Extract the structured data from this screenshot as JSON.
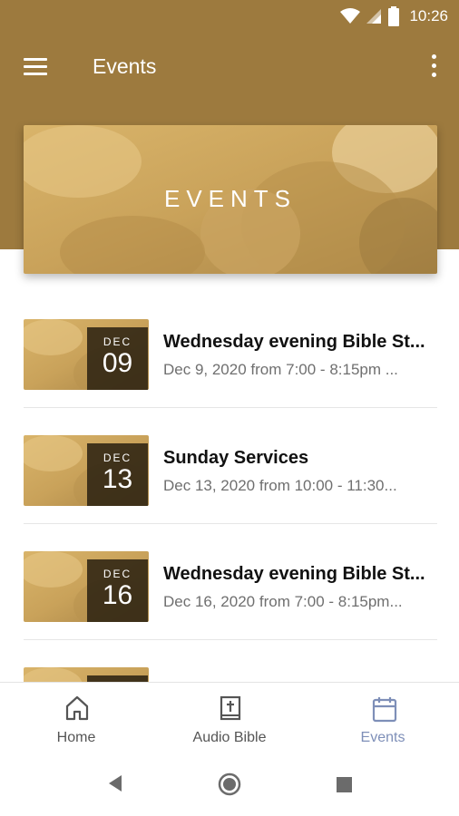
{
  "status_bar": {
    "time": "10:26"
  },
  "app_bar": {
    "title": "Events"
  },
  "hero": {
    "text": "EVENTS"
  },
  "events": [
    {
      "month": "DEC",
      "day": "09",
      "title": "Wednesday evening Bible St...",
      "subtitle": "Dec 9, 2020 from 7:00 - 8:15pm ..."
    },
    {
      "month": "DEC",
      "day": "13",
      "title": "Sunday Services",
      "subtitle": "Dec 13, 2020 from 10:00 - 11:30..."
    },
    {
      "month": "DEC",
      "day": "16",
      "title": "Wednesday evening Bible St...",
      "subtitle": "Dec 16, 2020 from 7:00 - 8:15pm..."
    }
  ],
  "bottom_nav": {
    "items": [
      {
        "label": "Home",
        "icon": "home-icon"
      },
      {
        "label": "Audio Bible",
        "icon": "bible-icon"
      },
      {
        "label": "Events",
        "icon": "calendar-icon",
        "active": true
      }
    ]
  },
  "colors": {
    "brand": "#9d7a3e",
    "active_nav": "#7e8fb8",
    "date_box": "#2d2312"
  }
}
